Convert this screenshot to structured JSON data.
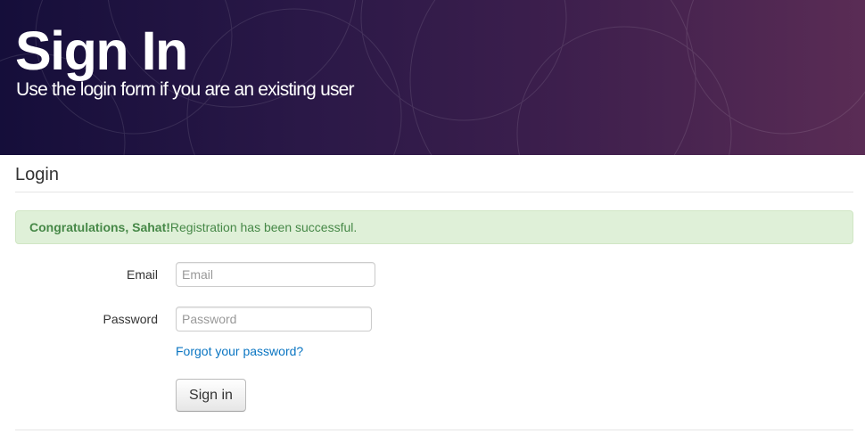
{
  "hero": {
    "title": "Sign In",
    "subtitle": "Use the login form if you are an existing user",
    "gradient_colors": [
      "#150e3a",
      "#2a1847",
      "#3d1f4d",
      "#5a2c55"
    ]
  },
  "section": {
    "title": "Login"
  },
  "alert": {
    "strong_text": "Congratulations, Sahat!",
    "message": "Registration has been successful.",
    "background_color": "#dff0d8",
    "text_color": "#468847"
  },
  "form": {
    "email": {
      "label": "Email",
      "placeholder": "Email",
      "value": ""
    },
    "password": {
      "label": "Password",
      "placeholder": "Password",
      "value": ""
    },
    "forgot_link": "Forgot your password?",
    "submit_label": "Sign in",
    "link_color": "#0a75c2"
  }
}
